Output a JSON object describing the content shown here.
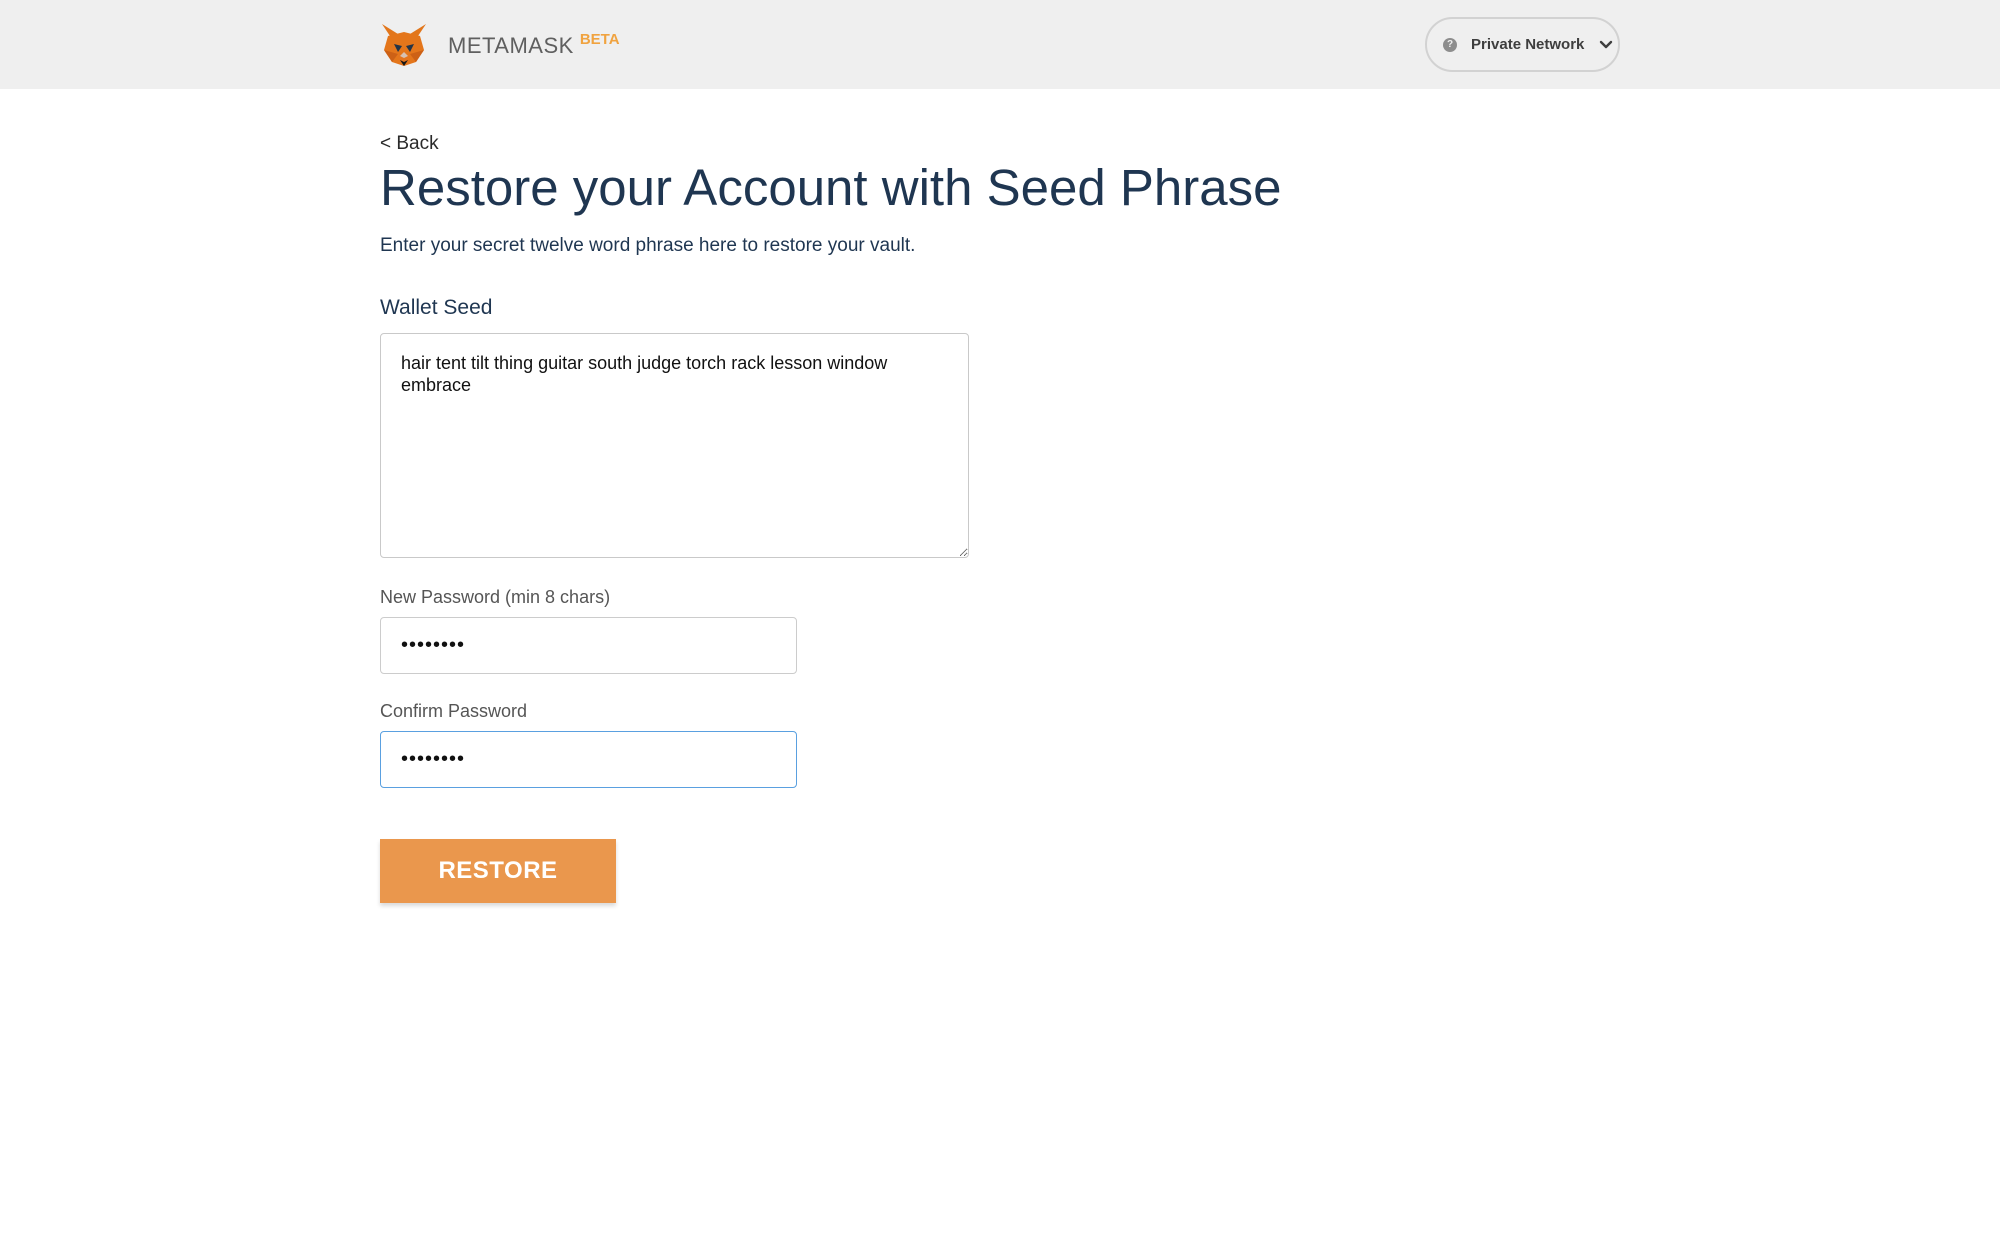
{
  "header": {
    "brand_name": "METAMASK",
    "brand_tag": "BETA",
    "network_help_glyph": "?",
    "network_label": "Private Network",
    "icons": [
      "fox-logo-icon",
      "help-icon",
      "chevron-down-icon"
    ]
  },
  "page": {
    "back_label": "< Back",
    "title": "Restore your Account with Seed Phrase",
    "subtitle": "Enter your secret twelve word phrase here to restore your vault."
  },
  "form": {
    "seed_label": "Wallet Seed",
    "seed_value": "hair tent tilt thing guitar south judge torch rack lesson window embrace",
    "password_label": "New Password (min 8 chars)",
    "password_value": "••••••••",
    "confirm_label": "Confirm Password",
    "confirm_value": "••••••••",
    "restore_label": "RESTORE"
  },
  "colors": {
    "header_bg": "#efefef",
    "title_color": "#1f3651",
    "accent_orange": "#ea974d",
    "beta_color": "#f0a340",
    "focus_border": "#5aa0e0"
  }
}
